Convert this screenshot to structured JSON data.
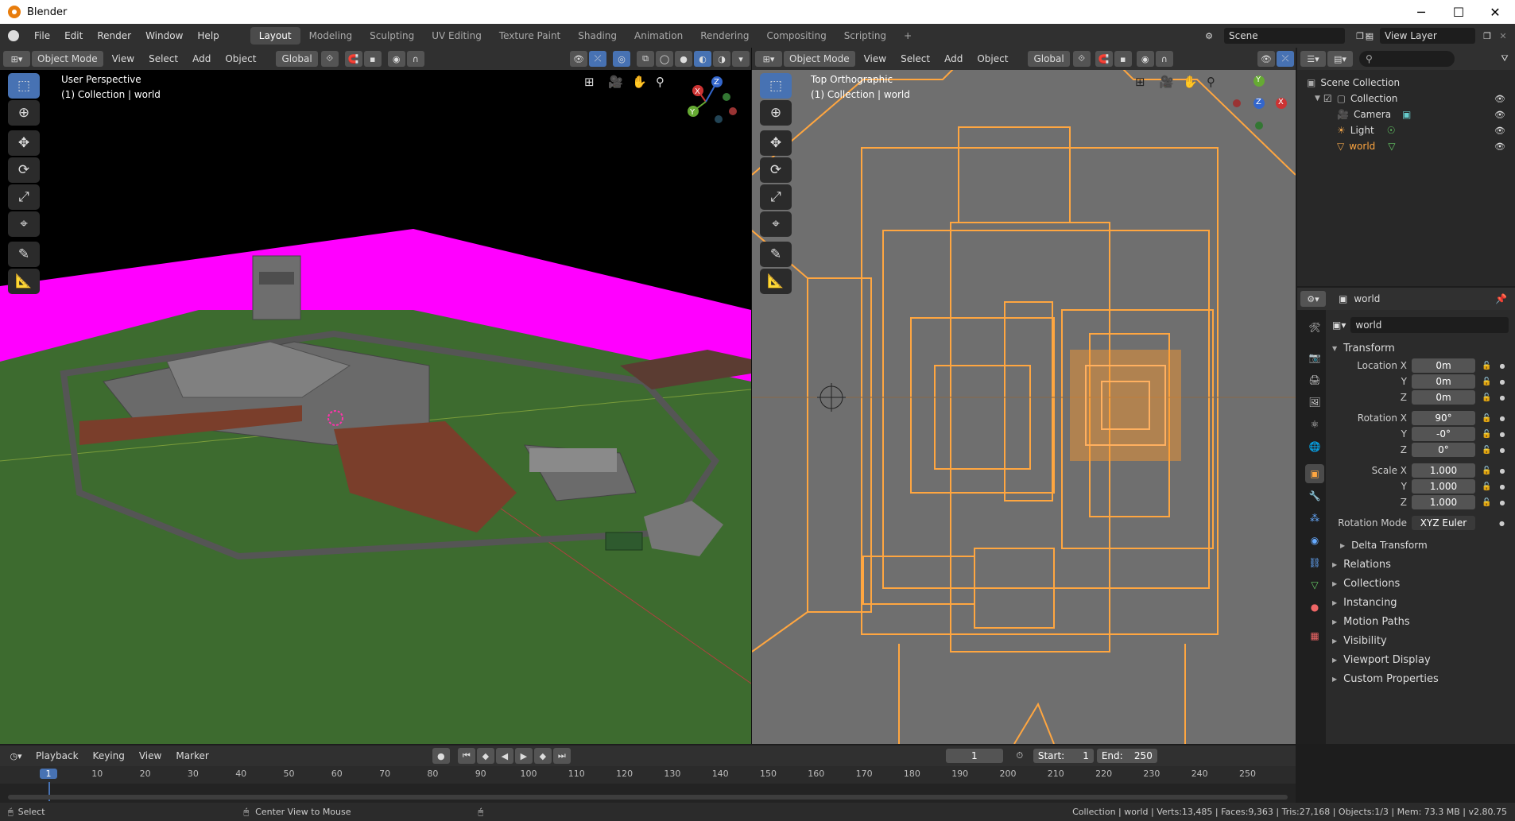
{
  "window": {
    "title": "Blender",
    "minimize": "─",
    "maximize": "☐",
    "close": "✕"
  },
  "menu": {
    "items": [
      "File",
      "Edit",
      "Render",
      "Window",
      "Help"
    ]
  },
  "workspaces": [
    "Layout",
    "Modeling",
    "Sculpting",
    "UV Editing",
    "Texture Paint",
    "Shading",
    "Animation",
    "Rendering",
    "Compositing",
    "Scripting"
  ],
  "workspace_add": "+",
  "scene": {
    "label": "Scene"
  },
  "view_layer": {
    "label": "View Layer"
  },
  "viewport_left": {
    "mode": "Object Mode",
    "view": "View",
    "select": "Select",
    "add": "Add",
    "object": "Object",
    "transform": "Global",
    "title": "User Perspective",
    "collection": "(1) Collection | world"
  },
  "viewport_right": {
    "mode": "Object Mode",
    "view": "View",
    "select": "Select",
    "add": "Add",
    "object": "Object",
    "transform": "Global",
    "title": "Top Orthographic",
    "collection": "(1) Collection | world"
  },
  "gizmo": {
    "x": "X",
    "y": "Y",
    "z": "Z"
  },
  "outliner": {
    "search_placeholder": "",
    "items": [
      {
        "label": "Scene Collection"
      },
      {
        "label": "Collection"
      },
      {
        "label": "Camera"
      },
      {
        "label": "Light"
      },
      {
        "label": "world"
      }
    ]
  },
  "properties": {
    "object_name": "world",
    "name_field": "world",
    "transform_label": "Transform",
    "location": {
      "label": "Location X",
      "x": "0m",
      "y": "0m",
      "z": "0m"
    },
    "rotation": {
      "label": "Rotation X",
      "x": "90°",
      "y": "-0°",
      "z": "0°"
    },
    "scale": {
      "label": "Scale X",
      "x": "1.000",
      "y": "1.000",
      "z": "1.000"
    },
    "axis_y": "Y",
    "axis_z": "Z",
    "rotation_mode": {
      "label": "Rotation Mode",
      "value": "XYZ Euler"
    },
    "delta_transform": "Delta Transform",
    "panels": [
      "Relations",
      "Collections",
      "Instancing",
      "Motion Paths",
      "Visibility",
      "Viewport Display",
      "Custom Properties"
    ]
  },
  "timeline": {
    "playback": "Playback",
    "keying": "Keying",
    "view": "View",
    "marker": "Marker",
    "current_frame": "1",
    "start_label": "Start:",
    "start": "1",
    "end_label": "End:",
    "end": "250",
    "ruler": [
      "1",
      "10",
      "20",
      "30",
      "40",
      "50",
      "60",
      "70",
      "80",
      "90",
      "100",
      "110",
      "120",
      "130",
      "140",
      "150",
      "160",
      "170",
      "180",
      "190",
      "200",
      "210",
      "220",
      "230",
      "240",
      "250"
    ]
  },
  "status": {
    "select": "Select",
    "center": "Center View to Mouse",
    "stats": "Collection | world | Verts:13,485 | Faces:9,363 | Tris:27,168 | Objects:1/3 | Mem: 73.3 MB | v2.80.75"
  },
  "colors": {
    "accent": "#4772b3",
    "selected": "#ffa640",
    "magenta": "#ff00ff",
    "grass": "#3d6b2f",
    "ortho_bg": "#6f6f6f"
  }
}
